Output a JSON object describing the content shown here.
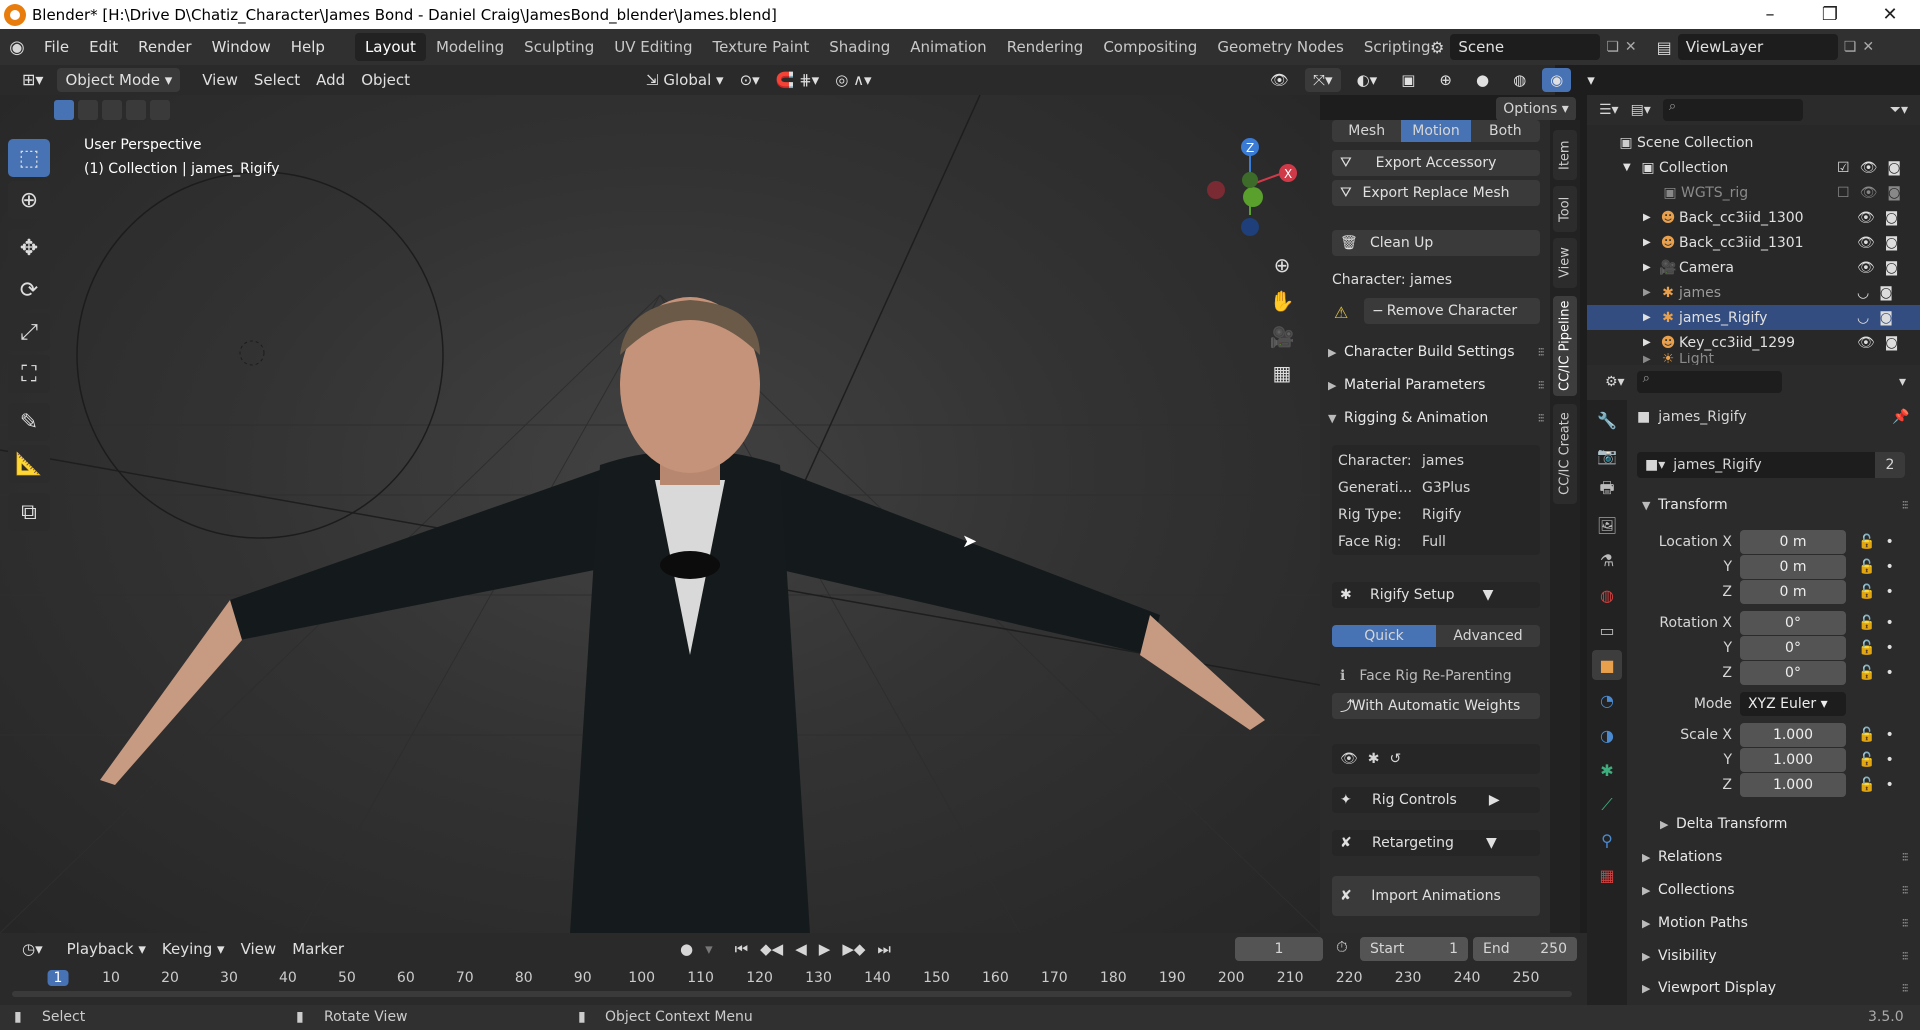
{
  "window": {
    "title": "Blender* [H:\\Drive D\\Chatiz_Character\\James Bond - Daniel Craig\\JamesBond_blender\\James.blend]"
  },
  "menu": [
    "File",
    "Edit",
    "Render",
    "Window",
    "Help"
  ],
  "workspaces": [
    "Layout",
    "Modeling",
    "Sculpting",
    "UV Editing",
    "Texture Paint",
    "Shading",
    "Animation",
    "Rendering",
    "Compositing",
    "Geometry Nodes",
    "Scripting"
  ],
  "scene": "Scene",
  "viewlayer": "ViewLayer",
  "viewport_header": {
    "mode": "Object Mode",
    "menus": [
      "View",
      "Select",
      "Add",
      "Object"
    ],
    "orientation": "Global",
    "options": "Options"
  },
  "viewport": {
    "perspective": "User Perspective",
    "collection_info": "(1) Collection | james_Rigify"
  },
  "npanel": {
    "tabs3": [
      "Mesh",
      "Motion",
      "Both"
    ],
    "export_accessory": "Export Accessory",
    "export_replace": "Export Replace Mesh",
    "clean_up": "Clean Up",
    "character_label": "Character: james",
    "remove_character": "Remove Character",
    "sections": [
      "Character Build Settings",
      "Material Parameters",
      "Rigging & Animation"
    ],
    "info": [
      {
        "k": "Character:",
        "v": "james"
      },
      {
        "k": "Generati...",
        "v": "G3Plus"
      },
      {
        "k": "Rig Type:",
        "v": "Rigify"
      },
      {
        "k": "Face Rig:",
        "v": "Full"
      }
    ],
    "rigify_setup": "Rigify Setup",
    "quick": "Quick",
    "advanced": "Advanced",
    "face_rig": "Face Rig Re-Parenting",
    "auto_weights": "With Automatic Weights",
    "rig_controls": "Rig Controls",
    "retargeting": "Retargeting",
    "import_anims": "Import Animations"
  },
  "vtabs": [
    "Item",
    "Tool",
    "View",
    "CC/IC Pipeline",
    "CC/IC Create"
  ],
  "outliner": {
    "scene_collection": "Scene Collection",
    "rows": [
      {
        "name": "Collection"
      },
      {
        "name": "WGTS_rig"
      },
      {
        "name": "Back_cc3iid_1300"
      },
      {
        "name": "Back_cc3iid_1301"
      },
      {
        "name": "Camera"
      },
      {
        "name": "james"
      },
      {
        "name": "james_Rigify"
      },
      {
        "name": "Key_cc3iid_1299"
      },
      {
        "name": "Light"
      }
    ]
  },
  "properties": {
    "object_name": "james_Rigify",
    "data_name": "james_Rigify",
    "users": "2",
    "transform": "Transform",
    "location": {
      "label": "Location X",
      "x": "0 m",
      "y": "0 m",
      "z": "0 m"
    },
    "rotation": {
      "label": "Rotation X",
      "x": "0°",
      "y": "0°",
      "z": "0°"
    },
    "mode_label": "Mode",
    "mode": "XYZ Euler",
    "scale": {
      "label": "Scale X",
      "x": "1.000",
      "y": "1.000",
      "z": "1.000"
    },
    "axis_y": "Y",
    "axis_z": "Z",
    "delta": "Delta Transform",
    "sections": [
      "Relations",
      "Collections",
      "Motion Paths",
      "Visibility",
      "Viewport Display"
    ]
  },
  "timeline": {
    "menus": [
      "Playback",
      "Keying",
      "View",
      "Marker"
    ],
    "current_frame": "1",
    "start_label": "Start",
    "start": "1",
    "end_label": "End",
    "end": "250",
    "ticks": [
      "1",
      "10",
      "20",
      "30",
      "40",
      "50",
      "60",
      "70",
      "80",
      "90",
      "100",
      "110",
      "120",
      "130",
      "140",
      "150",
      "160",
      "170",
      "180",
      "190",
      "200",
      "210",
      "220",
      "230",
      "240",
      "250"
    ]
  },
  "status": {
    "select": "Select",
    "rotate": "Rotate View",
    "context": "Object Context Menu",
    "version": "3.5.0"
  }
}
